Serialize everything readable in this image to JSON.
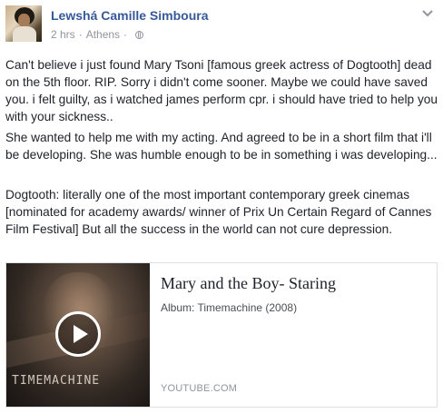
{
  "post": {
    "author": "Lewshá Camille Simboura",
    "time": "2 hrs",
    "separator": "·",
    "location": "Athens",
    "privacy_icon": "globe-icon",
    "menu_icon": "chevron-down-icon",
    "paragraphs": [
      "Can't believe i just found Mary Tsoni [famous greek actress of Dogtooth] dead on the 5th floor. RIP. Sorry i didn't come sooner. Maybe we could have saved you. i felt guilty, as i watched james perform cpr. i should have tried to help you with your sickness..",
      "She wanted to help me with my acting. And agreed to be in a short film that i'll be developing. She was humble enough to be in something i was developing...",
      "Dogtooth: literally one of the most important contemporary greek cinemas [nominated for academy awards/ winner of Prix Un Certain Regard of Cannes Film Festival] But all the success in the world can not cure depression."
    ]
  },
  "link_card": {
    "title": "Mary and the Boy- Staring",
    "description": "Album: Timemachine (2008)",
    "source": "YOUTUBE.COM",
    "thumbnail_text": "TIMEMACHINE",
    "play_icon": "play-icon"
  },
  "colors": {
    "author_link": "#365899",
    "body_text": "#1d2129",
    "muted": "#90949c",
    "card_border": "#dddfe2"
  }
}
